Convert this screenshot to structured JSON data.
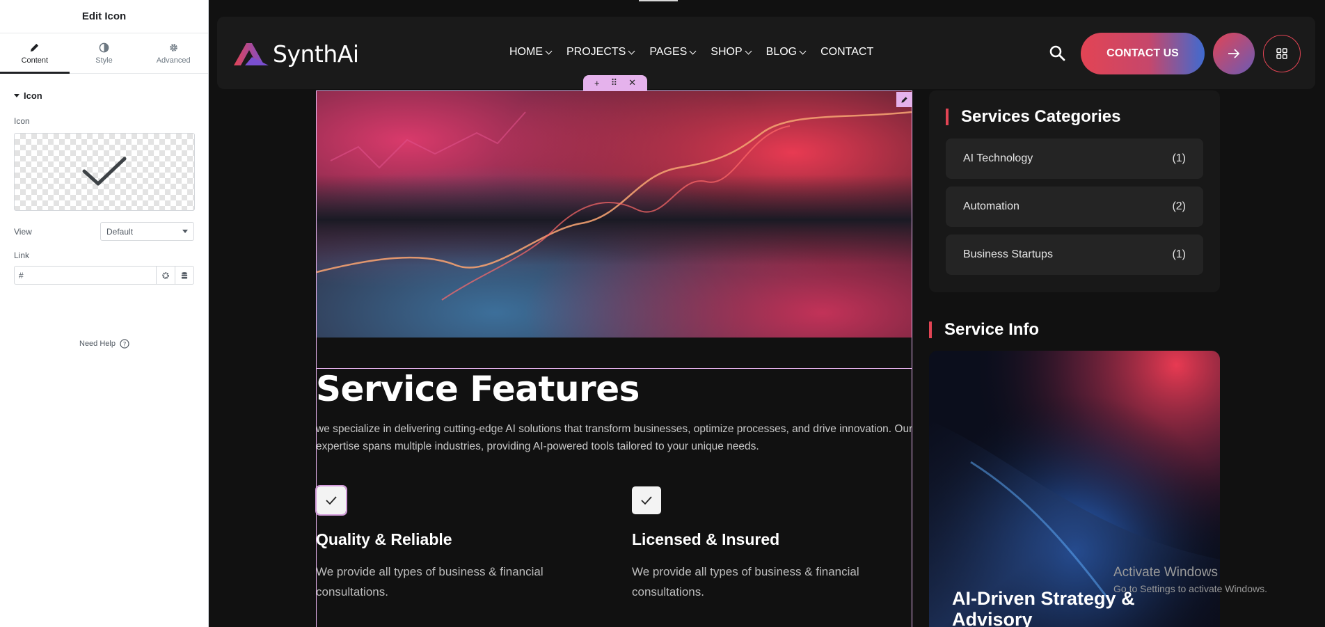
{
  "editor": {
    "title": "Edit Icon",
    "tabs": [
      {
        "label": "Content",
        "icon": "pencil-icon"
      },
      {
        "label": "Style",
        "icon": "contrast-icon"
      },
      {
        "label": "Advanced",
        "icon": "gear-icon"
      }
    ],
    "section_title": "Icon",
    "icon_label": "Icon",
    "icon_preview": "checkmark-icon",
    "view_label": "View",
    "view_value": "Default",
    "link_label": "Link",
    "link_value": "#",
    "need_help": "Need Help"
  },
  "site": {
    "logo_text": "SynthAi",
    "nav": [
      {
        "label": "HOME",
        "dropdown": true
      },
      {
        "label": "PROJECTS",
        "dropdown": true
      },
      {
        "label": "PAGES",
        "dropdown": true
      },
      {
        "label": "SHOP",
        "dropdown": true
      },
      {
        "label": "BLOG",
        "dropdown": true
      },
      {
        "label": "CONTACT",
        "dropdown": false
      }
    ],
    "cta_label": "CONTACT US",
    "main": {
      "title": "Service Features",
      "description": "we specialize in delivering cutting-edge AI solutions that transform businesses, optimize processes, and drive innovation. Our expertise spans multiple industries, providing AI-powered tools tailored to your unique needs.",
      "features": [
        {
          "title": "Quality & Reliable",
          "description": "We provide all types of business & financial consultations."
        },
        {
          "title": "Licensed & Insured",
          "description": "We provide all types of business & financial consultations."
        }
      ]
    },
    "sidebar": {
      "categories_title": "Services Categories",
      "categories": [
        {
          "name": "AI Technology",
          "count": "(1)"
        },
        {
          "name": "Automation",
          "count": "(2)"
        },
        {
          "name": "Business Startups",
          "count": "(1)"
        }
      ],
      "info_title": "Service Info",
      "info_card_title": "AI-Driven Strategy & Advisory"
    }
  },
  "watermark": {
    "line1": "Activate Windows",
    "line2": "Go to Settings to activate Windows."
  },
  "colors": {
    "accent": "#e24454",
    "selection": "#e5b2ec",
    "background": "#111111"
  }
}
